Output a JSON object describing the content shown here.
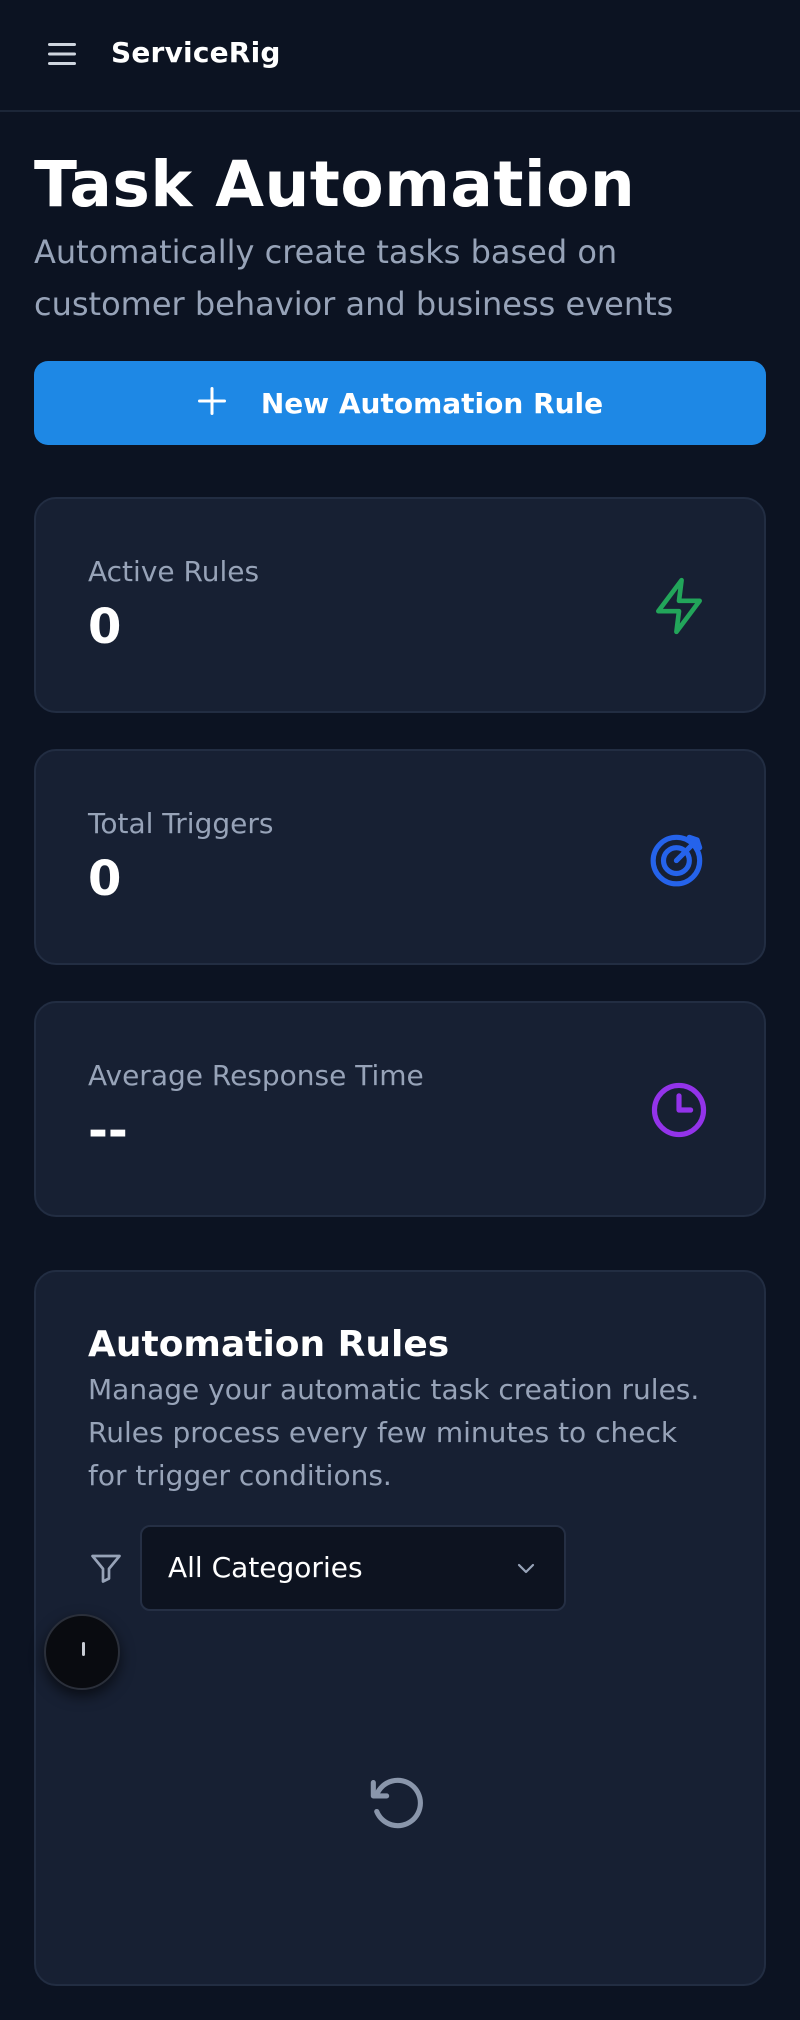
{
  "app": {
    "brand": "ServiceRig"
  },
  "header": {
    "title": "Task Automation",
    "subtitle": "Automatically create tasks based on customer behavior and business events"
  },
  "actions": {
    "new_rule_label": "New Automation Rule"
  },
  "stats": [
    {
      "label": "Active Rules",
      "value": "0",
      "icon": "lightning-bolt-icon",
      "color": "#22a55a"
    },
    {
      "label": "Total Triggers",
      "value": "0",
      "icon": "target-icon",
      "color": "#2563eb"
    },
    {
      "label": "Average Response Time",
      "value": "--",
      "icon": "clock-icon",
      "color": "#9333ea"
    }
  ],
  "rules": {
    "title": "Automation Rules",
    "description": "Manage your automatic task creation rules. Rules process every few minutes to check for trigger conditions.",
    "filter": {
      "selected": "All Categories"
    }
  },
  "colors": {
    "background": "#0c1322",
    "card": "#172033",
    "accent": "#1e88e5",
    "muted_text": "#97a3b8"
  }
}
